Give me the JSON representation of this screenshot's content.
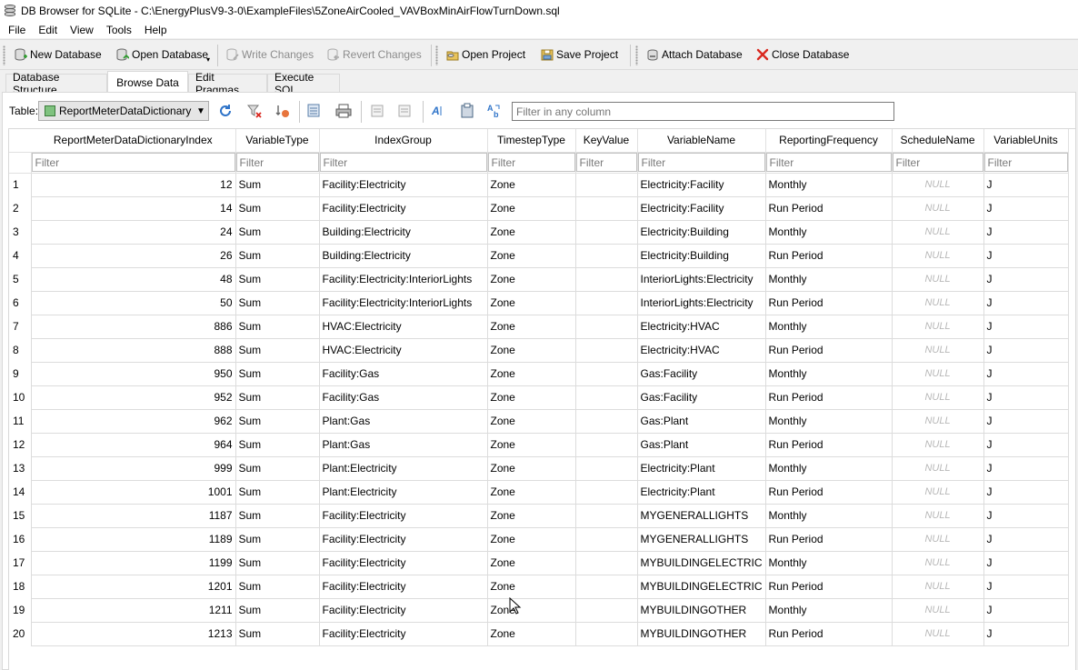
{
  "window": {
    "title": "DB Browser for SQLite - C:\\EnergyPlusV9-3-0\\ExampleFiles\\5ZoneAirCooled_VAVBoxMinAirFlowTurnDown.sql"
  },
  "menu": [
    {
      "label": "File"
    },
    {
      "label": "Edit"
    },
    {
      "label": "View"
    },
    {
      "label": "Tools"
    },
    {
      "label": "Help"
    }
  ],
  "toolbar": {
    "new_database": "New Database",
    "open_database": "Open Database",
    "write_changes": "Write Changes",
    "revert_changes": "Revert Changes",
    "open_project": "Open Project",
    "save_project": "Save Project",
    "attach_database": "Attach Database",
    "close_database": "Close Database"
  },
  "tabs": [
    {
      "label": "Database Structure"
    },
    {
      "label": "Browse Data"
    },
    {
      "label": "Edit Pragmas"
    },
    {
      "label": "Execute SQL"
    }
  ],
  "browse": {
    "table_label": "Table:",
    "table_name": "ReportMeterDataDictionary",
    "filter_all_placeholder": "Filter in any column",
    "filter_placeholder": "Filter",
    "null_text": "NULL",
    "columns": [
      "ReportMeterDataDictionaryIndex",
      "VariableType",
      "IndexGroup",
      "TimestepType",
      "KeyValue",
      "VariableName",
      "ReportingFrequency",
      "ScheduleName",
      "VariableUnits"
    ],
    "rows": [
      [
        "1",
        "12",
        "Sum",
        "Facility:Electricity",
        "Zone",
        "",
        "Electricity:Facility",
        "Monthly",
        "NULL",
        "J"
      ],
      [
        "2",
        "14",
        "Sum",
        "Facility:Electricity",
        "Zone",
        "",
        "Electricity:Facility",
        "Run Period",
        "NULL",
        "J"
      ],
      [
        "3",
        "24",
        "Sum",
        "Building:Electricity",
        "Zone",
        "",
        "Electricity:Building",
        "Monthly",
        "NULL",
        "J"
      ],
      [
        "4",
        "26",
        "Sum",
        "Building:Electricity",
        "Zone",
        "",
        "Electricity:Building",
        "Run Period",
        "NULL",
        "J"
      ],
      [
        "5",
        "48",
        "Sum",
        "Facility:Electricity:InteriorLights",
        "Zone",
        "",
        "InteriorLights:Electricity",
        "Monthly",
        "NULL",
        "J"
      ],
      [
        "6",
        "50",
        "Sum",
        "Facility:Electricity:InteriorLights",
        "Zone",
        "",
        "InteriorLights:Electricity",
        "Run Period",
        "NULL",
        "J"
      ],
      [
        "7",
        "886",
        "Sum",
        "HVAC:Electricity",
        "Zone",
        "",
        "Electricity:HVAC",
        "Monthly",
        "NULL",
        "J"
      ],
      [
        "8",
        "888",
        "Sum",
        "HVAC:Electricity",
        "Zone",
        "",
        "Electricity:HVAC",
        "Run Period",
        "NULL",
        "J"
      ],
      [
        "9",
        "950",
        "Sum",
        "Facility:Gas",
        "Zone",
        "",
        "Gas:Facility",
        "Monthly",
        "NULL",
        "J"
      ],
      [
        "10",
        "952",
        "Sum",
        "Facility:Gas",
        "Zone",
        "",
        "Gas:Facility",
        "Run Period",
        "NULL",
        "J"
      ],
      [
        "11",
        "962",
        "Sum",
        "Plant:Gas",
        "Zone",
        "",
        "Gas:Plant",
        "Monthly",
        "NULL",
        "J"
      ],
      [
        "12",
        "964",
        "Sum",
        "Plant:Gas",
        "Zone",
        "",
        "Gas:Plant",
        "Run Period",
        "NULL",
        "J"
      ],
      [
        "13",
        "999",
        "Sum",
        "Plant:Electricity",
        "Zone",
        "",
        "Electricity:Plant",
        "Monthly",
        "NULL",
        "J"
      ],
      [
        "14",
        "1001",
        "Sum",
        "Plant:Electricity",
        "Zone",
        "",
        "Electricity:Plant",
        "Run Period",
        "NULL",
        "J"
      ],
      [
        "15",
        "1187",
        "Sum",
        "Facility:Electricity",
        "Zone",
        "",
        "MYGENERALLIGHTS",
        "Monthly",
        "NULL",
        "J"
      ],
      [
        "16",
        "1189",
        "Sum",
        "Facility:Electricity",
        "Zone",
        "",
        "MYGENERALLIGHTS",
        "Run Period",
        "NULL",
        "J"
      ],
      [
        "17",
        "1199",
        "Sum",
        "Facility:Electricity",
        "Zone",
        "",
        "MYBUILDINGELECTRIC",
        "Monthly",
        "NULL",
        "J"
      ],
      [
        "18",
        "1201",
        "Sum",
        "Facility:Electricity",
        "Zone",
        "",
        "MYBUILDINGELECTRIC",
        "Run Period",
        "NULL",
        "J"
      ],
      [
        "19",
        "1211",
        "Sum",
        "Facility:Electricity",
        "Zone",
        "",
        "MYBUILDINGOTHER",
        "Monthly",
        "NULL",
        "J"
      ],
      [
        "20",
        "1213",
        "Sum",
        "Facility:Electricity",
        "Zone",
        "",
        "MYBUILDINGOTHER",
        "Run Period",
        "NULL",
        "J"
      ]
    ]
  },
  "colors": {
    "null_text": "#b8b8b8",
    "close_red": "#d9281f",
    "grid_line": "#dcdcdc"
  }
}
